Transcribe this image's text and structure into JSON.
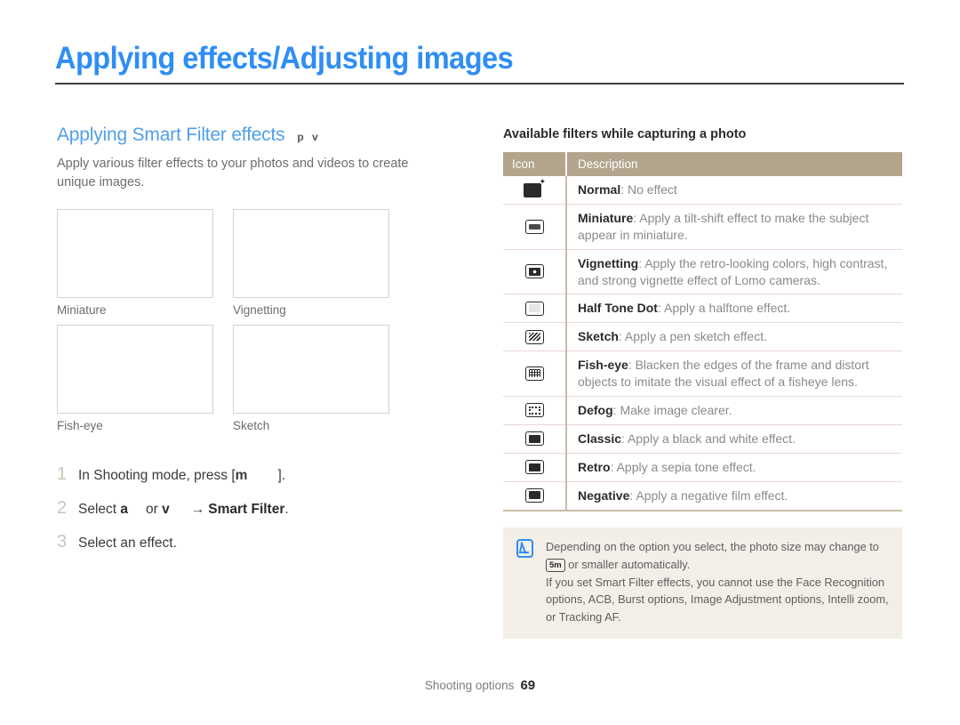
{
  "page": {
    "title": "Applying effects/Adjusting images",
    "footer_section": "Shooting options",
    "footer_page": "69"
  },
  "left": {
    "heading": "Applying Smart Filter effects",
    "mode_icons": "p v",
    "intro": "Apply various filter effects to your photos and videos to create unique images.",
    "samples": [
      {
        "caption": "Miniature"
      },
      {
        "caption": "Vignetting"
      },
      {
        "caption": "Fish-eye"
      },
      {
        "caption": "Sketch"
      }
    ],
    "steps": [
      {
        "num": "1",
        "pre": "In Shooting mode, press [",
        "key": "m",
        "post": "]."
      },
      {
        "num": "2",
        "pre": "Select ",
        "key1": "a",
        "mid": "or ",
        "key2": "v",
        "arrow": "→",
        "bold": "Smart Filter",
        "post": "."
      },
      {
        "num": "3",
        "pre": "Select an effect."
      }
    ]
  },
  "table": {
    "caption": "Available filters while capturing a photo",
    "headers": {
      "icon": "Icon",
      "description": "Description"
    },
    "rows": [
      {
        "icon": "normal-filter-icon",
        "name": "Normal",
        "desc": ": No effect"
      },
      {
        "icon": "miniature-filter-icon",
        "name": "Miniature",
        "desc": ": Apply a tilt-shift effect to make the subject appear in miniature."
      },
      {
        "icon": "vignetting-filter-icon",
        "name": "Vignetting",
        "desc": ": Apply the retro-looking colors, high contrast, and strong vignette effect of Lomo cameras."
      },
      {
        "icon": "halftone-filter-icon",
        "name": "Half Tone Dot",
        "desc": ": Apply a halftone effect."
      },
      {
        "icon": "sketch-filter-icon",
        "name": "Sketch",
        "desc": ": Apply a pen sketch effect."
      },
      {
        "icon": "fisheye-filter-icon",
        "name": "Fish-eye",
        "desc": ": Blacken the edges of the frame and distort objects to imitate the visual effect of a fisheye lens."
      },
      {
        "icon": "defog-filter-icon",
        "name": "Defog",
        "desc": ": Make image clearer."
      },
      {
        "icon": "classic-filter-icon",
        "name": "Classic",
        "desc": ": Apply a black and white effect."
      },
      {
        "icon": "retro-filter-icon",
        "name": "Retro",
        "desc": ": Apply a sepia tone effect."
      },
      {
        "icon": "negative-filter-icon",
        "name": "Negative",
        "desc": ": Apply a negative film effect."
      }
    ]
  },
  "note": {
    "line1_pre": "Depending on the option you select, the photo size may change to ",
    "badge": "5m",
    "line1_post": " or smaller automatically.",
    "line2": "If you set Smart Filter effects, you cannot use the Face Recognition options, ACB, Burst options, Image Adjustment options, Intelli zoom, or Tracking AF."
  },
  "colors": {
    "title_blue": "#2f8ef4",
    "heading_blue": "#4fa0e8",
    "table_header_tan": "#b3a48d",
    "note_bg": "#f3efe8"
  }
}
